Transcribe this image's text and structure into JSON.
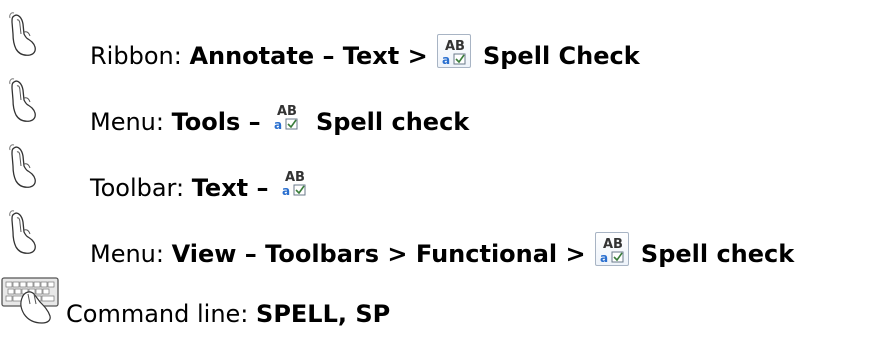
{
  "rows": [
    {
      "icon": "mouse-icon",
      "label": "Ribbon:",
      "path": "Annotate – Text >",
      "tool_icon": "spell-check-icon",
      "tool_name": "Spell Check"
    },
    {
      "icon": "mouse-icon",
      "label": "Menu:",
      "path": "Tools –",
      "tool_icon": "spell-check-icon",
      "tool_name": "Spell check"
    },
    {
      "icon": "mouse-icon",
      "label": "Toolbar:",
      "path": "Text –",
      "tool_icon": "spell-check-icon"
    },
    {
      "icon": "mouse-icon",
      "label": "Menu:",
      "path": "View – Toolbars > Functional >",
      "tool_icon": "spell-check-icon",
      "tool_name": "Spell check"
    },
    {
      "icon": "keyboard-icon",
      "label": "Command line:",
      "command": "SPELL, SP"
    }
  ],
  "spell_icon_text": {
    "upper": "AB",
    "lower": "a"
  },
  "colors": {
    "spell_icon_upper": "#333333",
    "spell_icon_lower": "#2a6fcf",
    "check": "#3a7d3a"
  }
}
